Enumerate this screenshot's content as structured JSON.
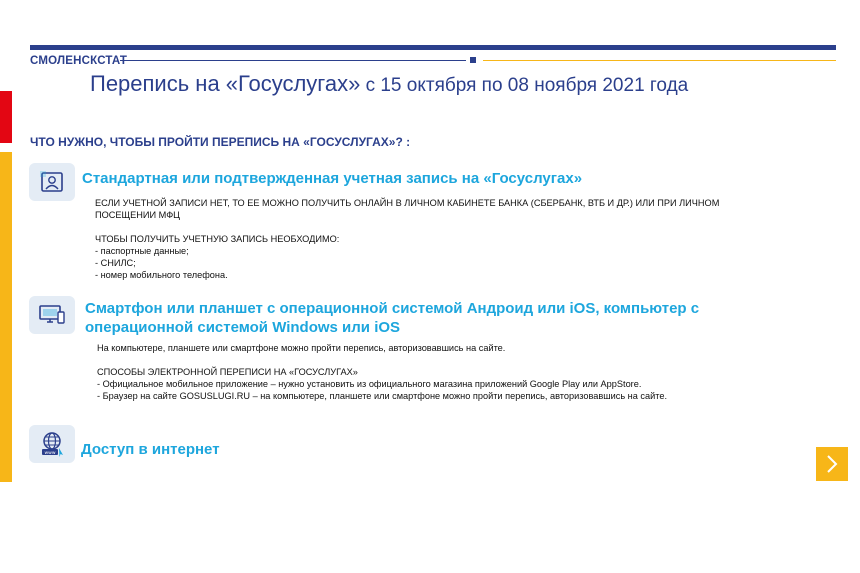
{
  "header": {
    "brand": "СМОЛЕНСКСТАТ",
    "title_main": "Перепись на «Госуслугах»",
    "title_sub": " с 15 октября по 08 ноября 2021 года"
  },
  "question": "ЧТО НУЖНО, ЧТОБЫ ПРОЙТИ ПЕРЕПИСЬ НА «ГОСУСЛУГАХ»? :",
  "sections": [
    {
      "icon": "id-card-icon",
      "heading": "Стандартная или подтвержденная учетная запись на «Госуслугах»",
      "lines": [
        "ЕСЛИ УЧЕТНОЙ ЗАПИСИ НЕТ, ТО ЕЕ МОЖНО ПОЛУЧИТЬ ОНЛАЙН В ЛИЧНОМ КАБИНЕТЕ БАНКА (СБЕРБАНК, ВТБ И ДР.) ИЛИ ПРИ ЛИЧНОМ",
        "ПОСЕЩЕНИИ МФЦ",
        "",
        "ЧТОБЫ ПОЛУЧИТЬ УЧЕТНУЮ ЗАПИСЬ НЕОБХОДИМО:",
        "- паспортные данные;",
        "- СНИЛС;",
        "- номер мобильного телефона."
      ]
    },
    {
      "icon": "devices-icon",
      "heading_1": "Смартфон или планшет с операционной системой Андроид или iOS, компьютер с",
      "heading_2": "операционной системой Windows или iOS",
      "lines": [
        "На компьютере, планшете или смартфоне можно пройти перепись, авторизовавшись на сайте.",
        "",
        "СПОСОБЫ ЭЛЕКТРОННОЙ ПЕРЕПИСИ НА «ГОСУСЛУГАХ»",
        "-   Официальное мобильное приложение – нужно установить из официального магазина приложений Google Play или AppStore.",
        "-   Браузер на сайте GOSUSLUGI.RU – на компьютере, планшете или смартфоне можно пройти перепись, авторизовавшись на сайте."
      ]
    },
    {
      "icon": "globe-www-icon",
      "heading": "Доступ в интернет"
    }
  ],
  "colors": {
    "navy": "#2b3f8c",
    "cyan": "#1da6dd",
    "yellow": "#f7b618",
    "red": "#e30613"
  }
}
